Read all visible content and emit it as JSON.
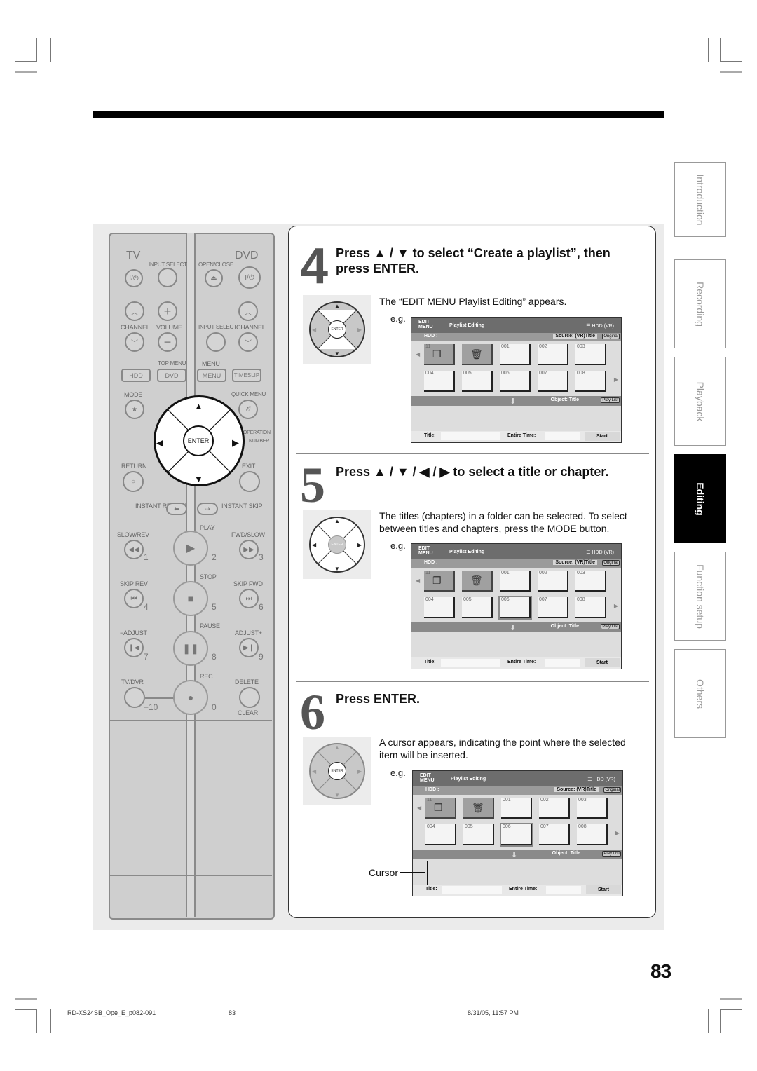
{
  "remote": {
    "tv_label": "TV",
    "dvd_label": "DVD",
    "input_select_left": "INPUT SELECT",
    "open_close": "OPEN/CLOSE",
    "power_glyph": "I/⏻",
    "eject_glyph": "⏏",
    "channel_left": "CHANNEL",
    "volume": "VOLUME",
    "input_select_right": "INPUT SELECT",
    "channel_right": "CHANNEL",
    "top_menu": "TOP MENU",
    "menu_top": "MENU",
    "hdd_btn": "HDD",
    "dvd_btn": "DVD",
    "menu_btn": "MENU",
    "timeslip_btn": "TIMESLIP",
    "mode": "MODE",
    "quick_menu": "QUICK MENU",
    "operation": "OPERATION",
    "number": "NUMBER",
    "enter": "ENTER",
    "return": "RETURN",
    "exit": "EXIT",
    "instant_replay": "INSTANT REPLAY",
    "instant_skip": "INSTANT SKIP",
    "play": "PLAY",
    "slow_rev": "SLOW/REV",
    "fwd_slow": "FWD/SLOW",
    "stop": "STOP",
    "skip_rev": "SKIP REV",
    "skip_fwd": "SKIP FWD",
    "pause": "PAUSE",
    "adjust_minus": "−ADJUST",
    "adjust_plus": "ADJUST+",
    "rec": "REC",
    "tv_dvr": "TV/DVR",
    "delete": "DELETE",
    "clear": "CLEAR",
    "plus10": "+10",
    "nums": [
      "1",
      "2",
      "3",
      "4",
      "5",
      "6",
      "7",
      "8",
      "9",
      "0"
    ]
  },
  "steps": [
    {
      "number": "4",
      "title": "Press ▲ / ▼ to select “Create a playlist”, then press ENTER.",
      "description": "The “EDIT MENU Playlist Editing” appears.",
      "eg": "e.g."
    },
    {
      "number": "5",
      "title": "Press ▲ / ▼ / ◀ / ▶ to select a title or chapter.",
      "description": "The titles (chapters) in a folder can be selected. To select between titles and chapters, press the MODE button.",
      "eg": "e.g."
    },
    {
      "number": "6",
      "title": "Press ENTER.",
      "description": "A cursor appears, indicating the point where the selected item will be inserted.",
      "eg": "e.g.",
      "cursor_label": "Cursor"
    }
  ],
  "osd": {
    "logo_line1": "EDIT",
    "logo_line2": "MENU",
    "title": "Playlist Editing",
    "hdd_vr": "HDD (VR)",
    "hdd_label": "HDD :",
    "source": "Source: (VR)Title",
    "original": "Original",
    "folder_num": "11",
    "thumbs_row1": [
      "001",
      "002",
      "003"
    ],
    "thumbs_row2": [
      "004",
      "005",
      "006",
      "007",
      "008"
    ],
    "object": "Object: Title",
    "play_list": "Play List",
    "title_label": "Title:",
    "entire_time": "Entire Time:",
    "start": "Start",
    "mini_enter": "ENTER"
  },
  "tabs": [
    {
      "label": "Introduction",
      "active": false
    },
    {
      "label": "Recording",
      "active": false
    },
    {
      "label": "Playback",
      "active": false
    },
    {
      "label": "Editing",
      "active": true
    },
    {
      "label": "Function setup",
      "active": false
    },
    {
      "label": "Others",
      "active": false
    }
  ],
  "page_number": "83",
  "footer": {
    "file": "RD-XS24SB_Ope_E_p082-091",
    "page": "83",
    "timestamp": "8/31/05, 11:57 PM"
  }
}
